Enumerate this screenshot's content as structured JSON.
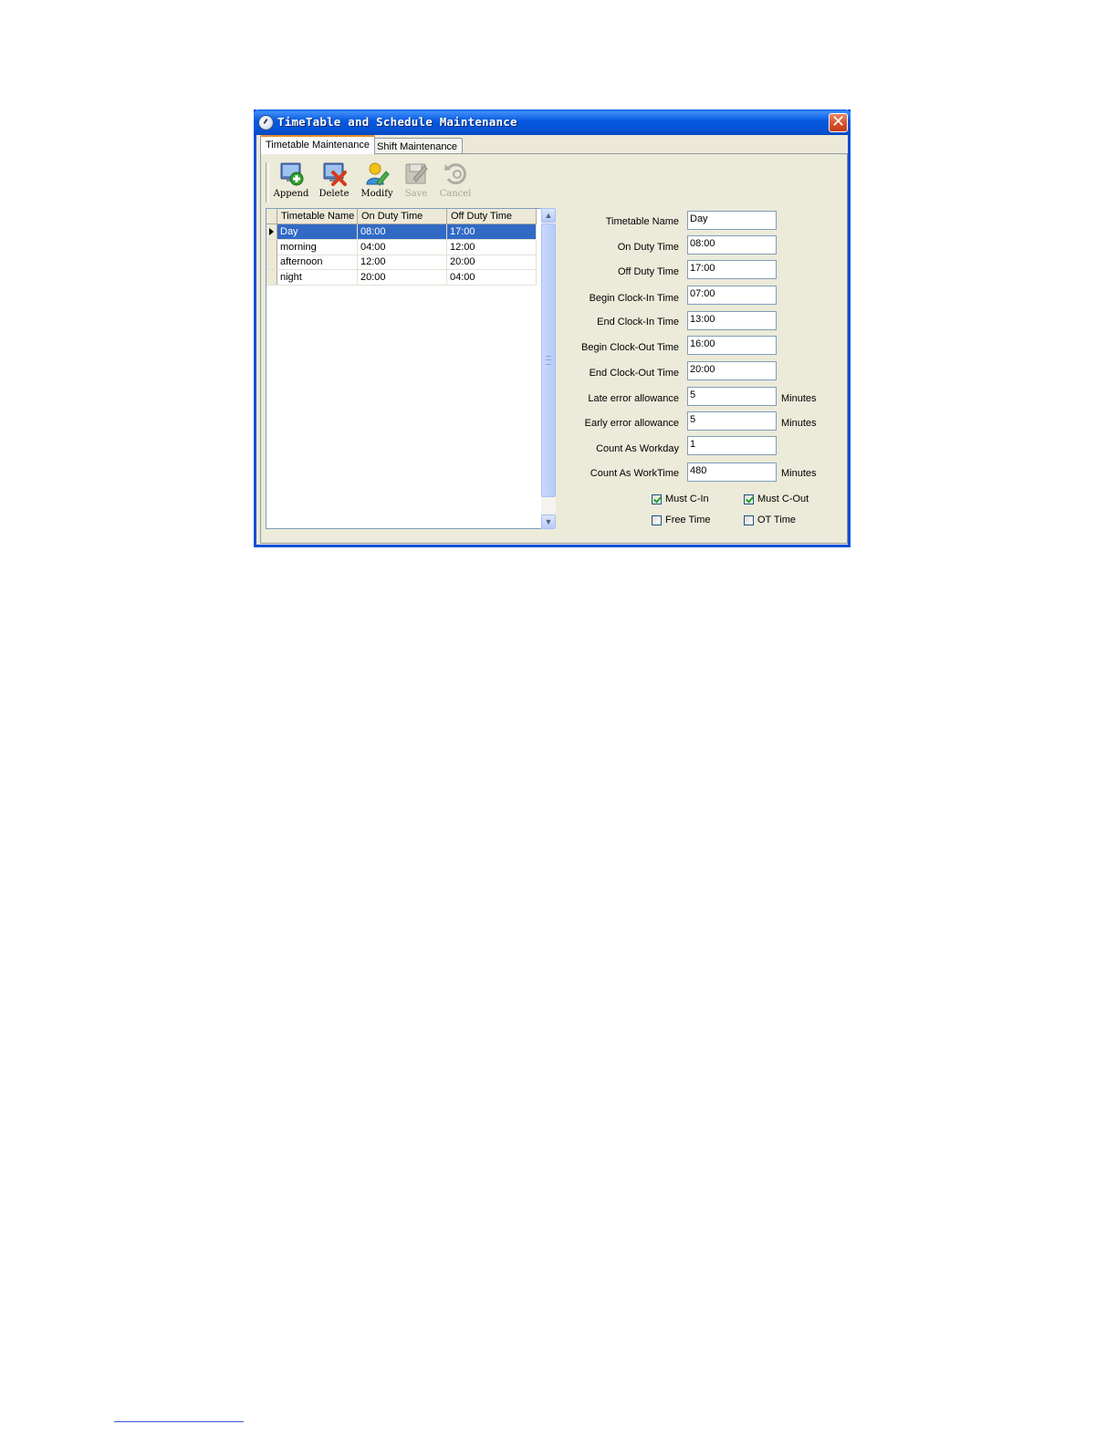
{
  "window": {
    "title": "TimeTable and Schedule Maintenance",
    "close_glyph": "✕"
  },
  "tabs": [
    {
      "label": "Timetable Maintenance",
      "active": true
    },
    {
      "label": "Shift Maintenance",
      "active": false
    }
  ],
  "toolbar": {
    "buttons": [
      {
        "label": "Append",
        "icon": "append-icon",
        "enabled": true
      },
      {
        "label": "Delete",
        "icon": "delete-icon",
        "enabled": true
      },
      {
        "label": "Modify",
        "icon": "modify-icon",
        "enabled": true
      },
      {
        "label": "Save",
        "icon": "save-icon",
        "enabled": false
      },
      {
        "label": "Cancel",
        "icon": "cancel-icon",
        "enabled": false
      }
    ]
  },
  "grid": {
    "columns": [
      "Timetable Name",
      "On Duty Time",
      "Off Duty Time"
    ],
    "rows": [
      {
        "name": "Day",
        "on": "08:00",
        "off": "17:00",
        "selected": true
      },
      {
        "name": "morning",
        "on": "04:00",
        "off": "12:00",
        "selected": false
      },
      {
        "name": "afternoon",
        "on": "12:00",
        "off": "20:00",
        "selected": false
      },
      {
        "name": "night",
        "on": "20:00",
        "off": "04:00",
        "selected": false
      }
    ]
  },
  "scrollbar": {
    "up_glyph": "▲",
    "down_glyph": "▼"
  },
  "form": {
    "fields": [
      {
        "label": "Timetable Name",
        "value": "Day",
        "unit": ""
      },
      {
        "label": "On Duty Time",
        "value": "08:00",
        "unit": ""
      },
      {
        "label": "Off Duty Time",
        "value": "17:00",
        "unit": ""
      },
      {
        "label": "Begin Clock-In Time",
        "value": "07:00",
        "unit": ""
      },
      {
        "label": "End Clock-In Time",
        "value": "13:00",
        "unit": ""
      },
      {
        "label": "Begin Clock-Out Time",
        "value": "16:00",
        "unit": ""
      },
      {
        "label": "End Clock-Out Time",
        "value": "20:00",
        "unit": ""
      },
      {
        "label": "Late error allowance",
        "value": "5",
        "unit": "Minutes"
      },
      {
        "label": "Early error allowance",
        "value": "5",
        "unit": "Minutes"
      },
      {
        "label": "Count As Workday",
        "value": "1",
        "unit": ""
      },
      {
        "label": "Count As WorkTime",
        "value": "480",
        "unit": "Minutes"
      }
    ],
    "checkboxes": [
      {
        "label": "Must C-In",
        "checked": true
      },
      {
        "label": "Must C-Out",
        "checked": true
      },
      {
        "label": "Free Time",
        "checked": false
      },
      {
        "label": "OT Time",
        "checked": false
      }
    ]
  },
  "colors": {
    "titlebar": "#0659e0",
    "selection": "#316ac5",
    "dialog_bg": "#ece9d8"
  }
}
